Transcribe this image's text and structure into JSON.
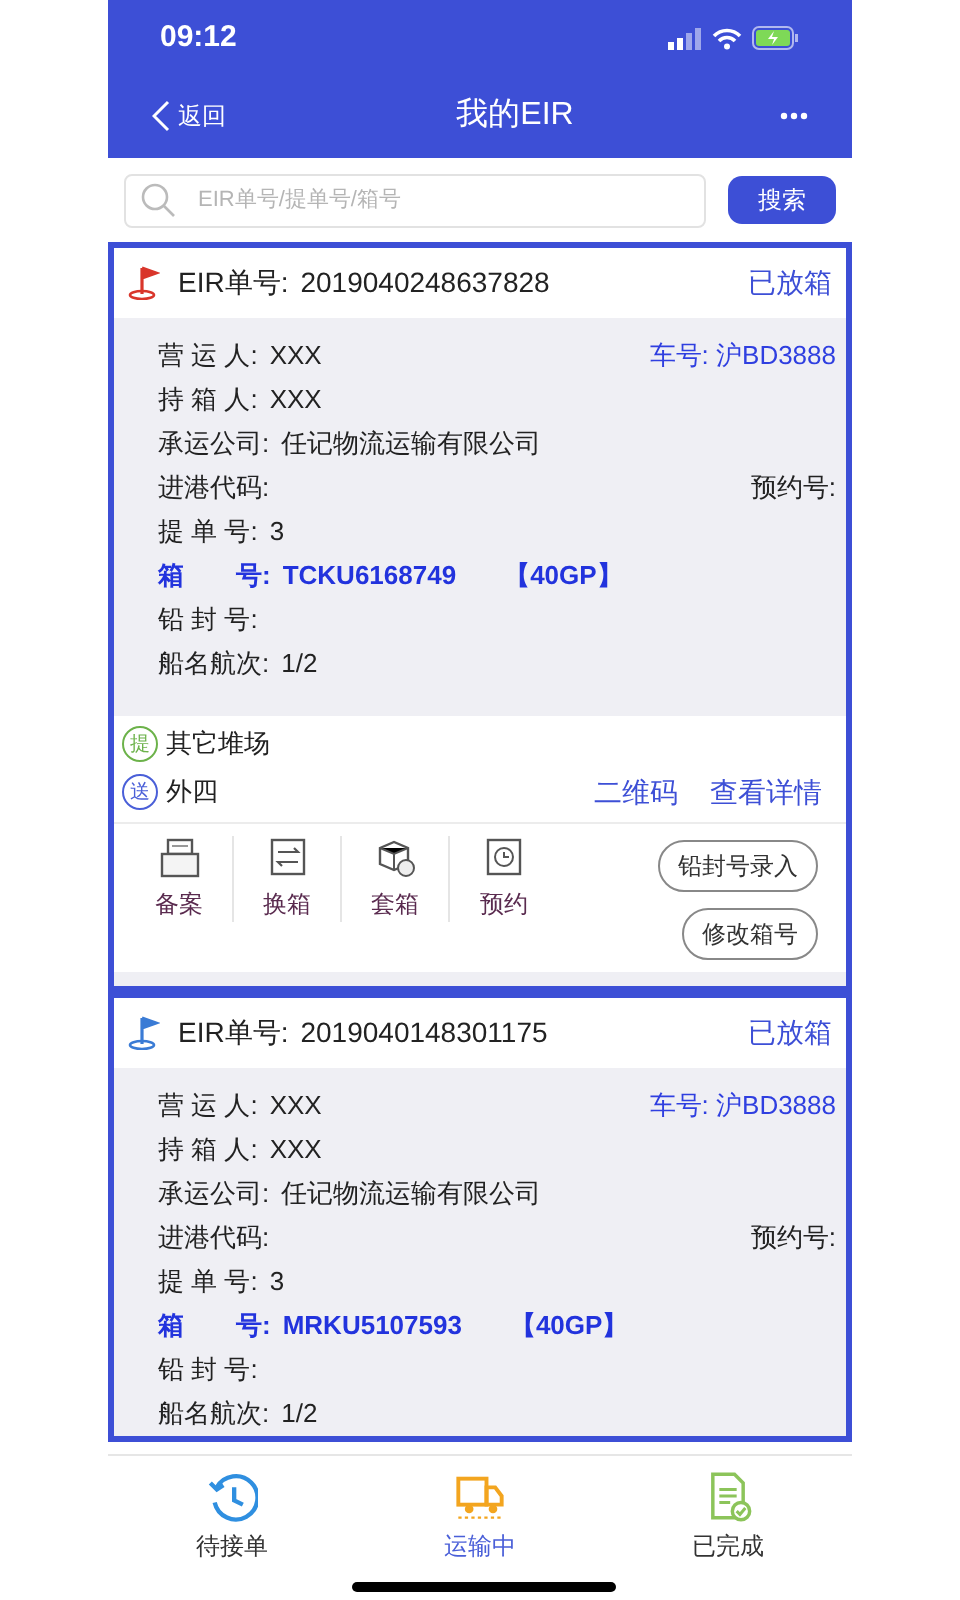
{
  "status_bar": {
    "time": "09:12"
  },
  "nav": {
    "back": "返回",
    "title": "我的EIR"
  },
  "search": {
    "placeholder": "EIR单号/提单号/箱号",
    "button": "搜索"
  },
  "cards": [
    {
      "eir_label": "EIR单号:",
      "eir_no": "2019040248637828",
      "color": "#d9362b",
      "status": "已放箱",
      "fields": [
        {
          "kind": "plain",
          "label": "营 运 人:",
          "value": "XXX",
          "right": "车号: 沪BD3888"
        },
        {
          "kind": "plain",
          "label": "持 箱 人:",
          "value": "XXX"
        },
        {
          "kind": "plain",
          "label": "承运公司:",
          "value": "任记物流运输有限公司"
        },
        {
          "kind": "plain",
          "label": "进港代码:",
          "right_plain": "预约号:"
        },
        {
          "kind": "plain",
          "label": "提 单 号:",
          "value": "3"
        },
        {
          "kind": "highlight",
          "label": "箱　　号:",
          "value": "TCKU6168749",
          "extra": "【40GP】"
        },
        {
          "kind": "plain",
          "label": "铅 封 号:"
        },
        {
          "kind": "plain",
          "label": "船名航次:",
          "value": "1/2"
        }
      ],
      "pickup": {
        "badge": "提",
        "place": "其它堆场"
      },
      "delivery": {
        "badge": "送",
        "place": "外四"
      },
      "links": [
        "二维码",
        "查看详情"
      ],
      "actions": [
        {
          "kind": "file",
          "label": "备案"
        },
        {
          "kind": "swap",
          "label": "换箱"
        },
        {
          "kind": "boxes",
          "label": "套箱"
        },
        {
          "kind": "clock",
          "label": "预约"
        }
      ],
      "buttons": [
        "铅封号录入",
        "修改箱号"
      ]
    },
    {
      "eir_label": "EIR单号:",
      "eir_no": "2019040148301175",
      "color": "#3a7bd5",
      "status": "已放箱",
      "fields": [
        {
          "kind": "plain",
          "label": "营 运 人:",
          "value": "XXX",
          "right": "车号: 沪BD3888"
        },
        {
          "kind": "plain",
          "label": "持 箱 人:",
          "value": "XXX"
        },
        {
          "kind": "plain",
          "label": "承运公司:",
          "value": "任记物流运输有限公司"
        },
        {
          "kind": "plain",
          "label": "进港代码:",
          "right_plain": "预约号:"
        },
        {
          "kind": "plain",
          "label": "提 单 号:",
          "value": "3"
        },
        {
          "kind": "highlight",
          "label": "箱　　号:",
          "value": "MRKU5107593",
          "extra": "【40GP】"
        },
        {
          "kind": "plain",
          "label": "铅 封 号:"
        },
        {
          "kind": "plain",
          "label": "船名航次:",
          "value": "1/2"
        }
      ]
    }
  ],
  "tabs": [
    {
      "kind": "clock",
      "label": "待接单",
      "selected": false
    },
    {
      "kind": "truck",
      "label": "运输中",
      "selected": true
    },
    {
      "kind": "done",
      "label": "已完成",
      "selected": false
    }
  ]
}
